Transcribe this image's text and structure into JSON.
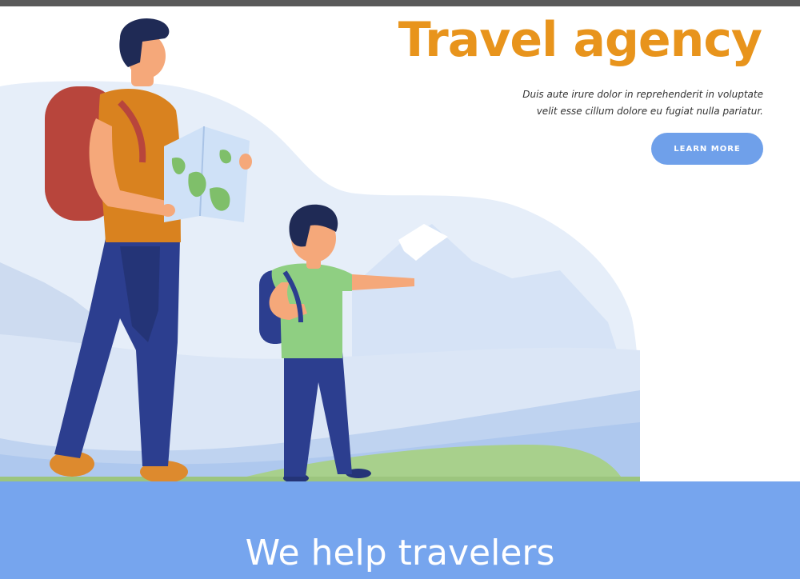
{
  "hero": {
    "title": "Travel agency",
    "tagline_line1": "Duis aute irure dolor in reprehenderit in voluptate",
    "tagline_line2": "velit esse cillum dolore eu fugiat nulla pariatur.",
    "cta_label": "LEARN MORE",
    "illustration": "father-and-son-hikers-with-map-and-backpacks"
  },
  "banner": {
    "title": "We help travelers"
  },
  "colors": {
    "title": "#e8941c",
    "accent_blue": "#76a5ee",
    "button": "#6fa0ea",
    "landscape": "#e6eef9"
  }
}
